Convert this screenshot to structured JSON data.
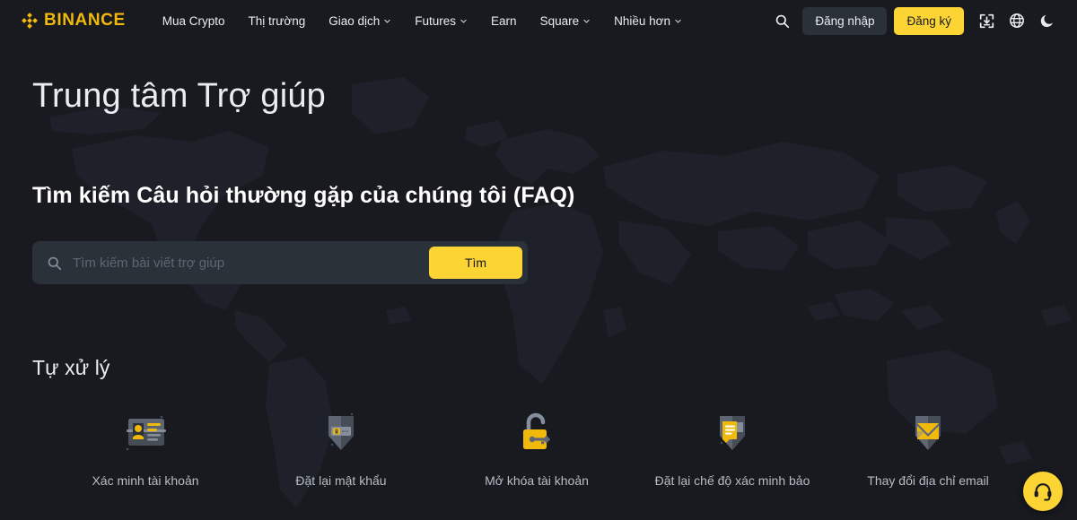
{
  "brand": {
    "name": "BINANCE",
    "logo_icon": "binance-diamond-logo",
    "accent_color": "#f0b90b",
    "button_color": "#fcd535",
    "background_color": "#181a20",
    "surface_color": "#2b3139"
  },
  "header": {
    "nav": [
      {
        "label": "Mua Crypto",
        "has_caret": false
      },
      {
        "label": "Thị trường",
        "has_caret": false
      },
      {
        "label": "Giao dịch",
        "has_caret": true
      },
      {
        "label": "Futures",
        "has_caret": true
      },
      {
        "label": "Earn",
        "has_caret": false
      },
      {
        "label": "Square",
        "has_caret": true
      },
      {
        "label": "Nhiều hơn",
        "has_caret": true
      }
    ],
    "search_icon": "search-icon",
    "login_label": "Đăng nhập",
    "register_label": "Đăng ký",
    "download_icon": "download-app-icon",
    "language_icon": "globe-icon",
    "theme_icon": "moon-icon"
  },
  "page": {
    "title": "Trung tâm Trợ giúp",
    "faq_heading": "Tìm kiếm Câu hỏi thường gặp của chúng tôi (FAQ)"
  },
  "search": {
    "placeholder": "Tìm kiếm bài viết trợ giúp",
    "value": "",
    "button_label": "Tìm",
    "icon": "search-icon"
  },
  "self_service": {
    "title": "Tự xử lý",
    "items": [
      {
        "label": "Xác minh tài khoản",
        "icon": "id-card-verify-icon"
      },
      {
        "label": "Đặt lại mật khẩu",
        "icon": "shield-password-icon"
      },
      {
        "label": "Mở khóa tài khoản",
        "icon": "unlock-padlock-key-icon"
      },
      {
        "label": "Đặt lại chế độ xác minh bảo",
        "icon": "shield-document-icon"
      },
      {
        "label": "Thay đổi địa chỉ email",
        "icon": "shield-envelope-icon"
      }
    ]
  },
  "support_fab": {
    "icon": "headset-support-icon",
    "label": "Hỗ trợ"
  }
}
